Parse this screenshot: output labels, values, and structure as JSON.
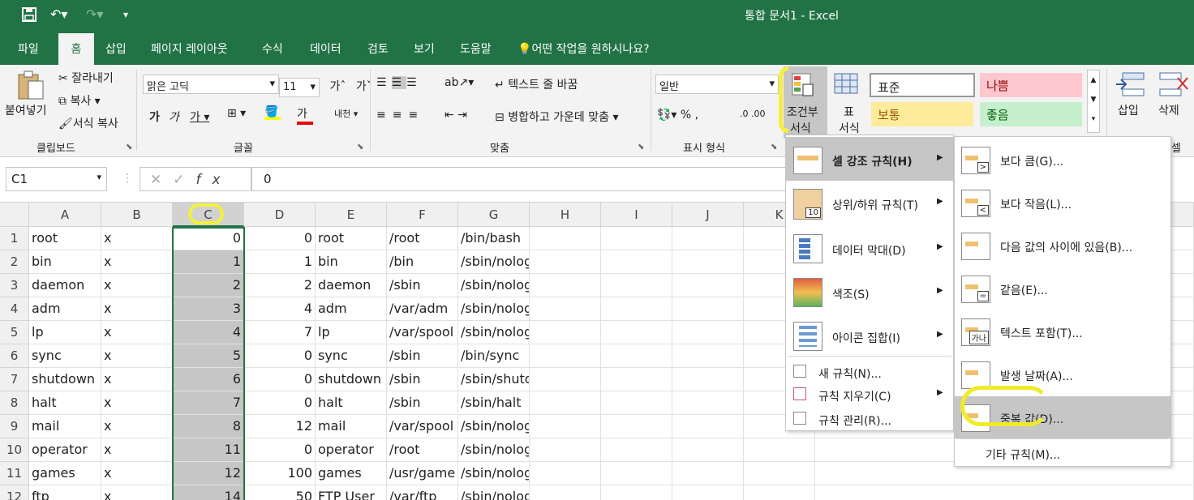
{
  "title": "통합 문서1  -  Excel",
  "tabs": [
    "파일",
    "홈",
    "삽입",
    "페이지 레이아웃",
    "수식",
    "데이터",
    "검토",
    "보기",
    "도움말",
    "어떤 작업을 원하시나요?"
  ],
  "clipboard": {
    "paste": "붙여넣기",
    "cut": "잘라내기",
    "copy": "복사",
    "format_painter": "서식 복사",
    "group": "클립보드"
  },
  "font": {
    "name": "맑은 고딕",
    "size": "11",
    "group": "글꼴"
  },
  "align": {
    "wrap": "텍스트 줄 바꿈",
    "merge": "병합하고 가운데 맞춤",
    "group": "맞춤"
  },
  "number": {
    "format": "일반",
    "group": "표시 형식"
  },
  "styles": {
    "cond_format_l1": "조건부",
    "cond_format_l2": "서식",
    "table_l1": "표",
    "table_l2": "서식",
    "normal": "표준",
    "bad": "나쁨",
    "neutral": "보통",
    "good": "좋음"
  },
  "cells": {
    "insert": "삽입",
    "delete": "삭제",
    "group_partial": "셀"
  },
  "namebox": "C1",
  "formula": "0",
  "columns": [
    "A",
    "B",
    "C",
    "D",
    "E",
    "F",
    "G",
    "H",
    "I",
    "J",
    "K"
  ],
  "rows": [
    {
      "n": "1",
      "a": "root",
      "b": "x",
      "c": "0",
      "d": "0",
      "e": "root",
      "f": "/root",
      "g": "/bin/bash"
    },
    {
      "n": "2",
      "a": "bin",
      "b": "x",
      "c": "1",
      "d": "1",
      "e": "bin",
      "f": "/bin",
      "g": "/sbin/nologin"
    },
    {
      "n": "3",
      "a": "daemon",
      "b": "x",
      "c": "2",
      "d": "2",
      "e": "daemon",
      "f": "/sbin",
      "g": "/sbin/nologin"
    },
    {
      "n": "4",
      "a": "adm",
      "b": "x",
      "c": "3",
      "d": "4",
      "e": "adm",
      "f": "/var/adm",
      "g": "/sbin/nologin"
    },
    {
      "n": "5",
      "a": "lp",
      "b": "x",
      "c": "4",
      "d": "7",
      "e": "lp",
      "f": "/var/spool",
      "g": "/sbin/nologin"
    },
    {
      "n": "6",
      "a": "sync",
      "b": "x",
      "c": "5",
      "d": "0",
      "e": "sync",
      "f": "/sbin",
      "g": "/bin/sync"
    },
    {
      "n": "7",
      "a": "shutdown",
      "b": "x",
      "c": "6",
      "d": "0",
      "e": "shutdown",
      "f": "/sbin",
      "g": "/sbin/shutdown"
    },
    {
      "n": "8",
      "a": "halt",
      "b": "x",
      "c": "7",
      "d": "0",
      "e": "halt",
      "f": "/sbin",
      "g": "/sbin/halt"
    },
    {
      "n": "9",
      "a": "mail",
      "b": "x",
      "c": "8",
      "d": "12",
      "e": "mail",
      "f": "/var/spool",
      "g": "/sbin/nologin"
    },
    {
      "n": "10",
      "a": "operator",
      "b": "x",
      "c": "11",
      "d": "0",
      "e": "operator",
      "f": "/root",
      "g": "/sbin/nologin"
    },
    {
      "n": "11",
      "a": "games",
      "b": "x",
      "c": "12",
      "d": "100",
      "e": "games",
      "f": "/usr/game",
      "g": "/sbin/nologin"
    },
    {
      "n": "12",
      "a": "ftp",
      "b": "x",
      "c": "14",
      "d": "50",
      "e": "FTP User",
      "f": "/var/ftp",
      "g": "/sbin/nologin"
    }
  ],
  "menu1": {
    "items": [
      "셀 강조 규칙(H)",
      "상위/하위 규칙(T)",
      "데이터 막대(D)",
      "색조(S)",
      "아이콘 집합(I)"
    ],
    "small": [
      "새 규칙(N)...",
      "규칙 지우기(C)",
      "규칙 관리(R)..."
    ]
  },
  "menu2": {
    "items": [
      "보다 큼(G)...",
      "보다 작음(L)...",
      "다음 값의 사이에 있음(B)...",
      "같음(E)...",
      "텍스트 포함(T)...",
      "발생 날짜(A)...",
      "중복 값(D)..."
    ],
    "more": "기타 규칙(M)..."
  },
  "colors": {
    "excel_green": "#217346",
    "selection": "#c6c6c6",
    "highlight": "#fff23a"
  }
}
